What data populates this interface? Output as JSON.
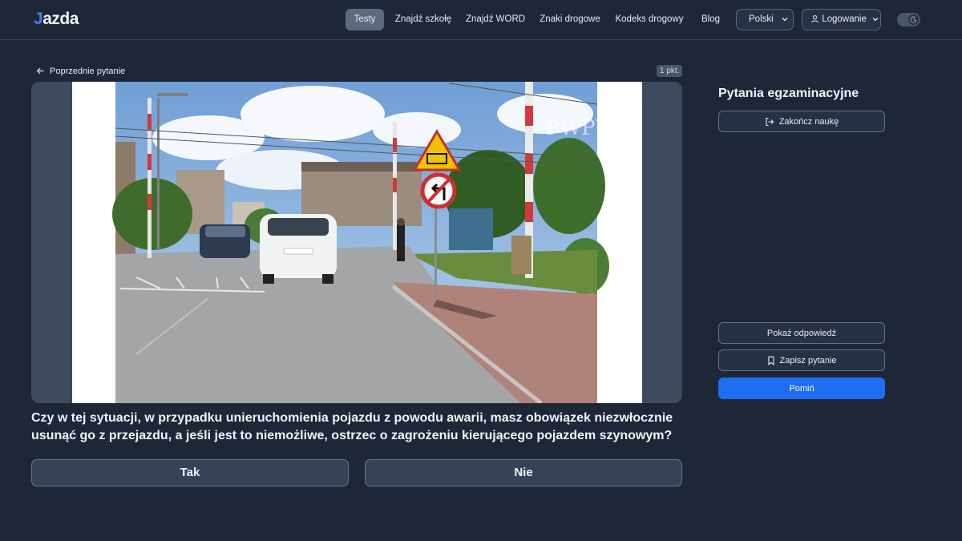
{
  "nav": {
    "logo_prefix": "J",
    "logo_rest": "azda",
    "items": [
      {
        "label": "Testy",
        "active": true
      },
      {
        "label": "Znajdź szkołę",
        "active": false
      },
      {
        "label": "Znajdź WORD",
        "active": false
      },
      {
        "label": "Znaki drogowe",
        "active": false
      },
      {
        "label": "Kodeks drogowy",
        "active": false
      },
      {
        "label": "Blog",
        "active": false
      }
    ],
    "language_label": "Polski",
    "login_label": "Logowanie",
    "theme_icon": "moon-icon"
  },
  "question": {
    "back_label": "Poprzednie pytanie",
    "points_label": "1 pkt.",
    "text": "Czy w tej sytuacji, w przypadku unieruchomienia pojazdu z powodu awarii, masz obowiązek niezwłocznie usunąć go z przejazdu, a jeśli jest to niemożliwe, ostrzec o zagrożeniu kierującego pojazdem szynowym?",
    "answers": [
      "Tak",
      "Nie"
    ],
    "watermark": "PWPW"
  },
  "sidebar": {
    "title": "Pytania egzaminacyjne",
    "end_label": "Zakończ naukę",
    "show_answer_label": "Pokaż odpowiedź",
    "save_label": "Zapisz pytanie",
    "skip_label": "Pomiń"
  },
  "colors": {
    "background": "#1e2738",
    "accent": "#1f6df0",
    "logo_accent": "#3b82f6"
  }
}
